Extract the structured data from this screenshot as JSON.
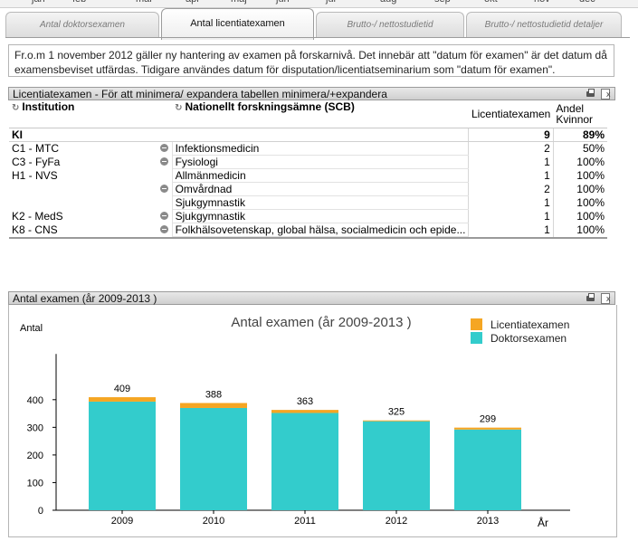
{
  "months": [
    "jan",
    "feb",
    "mar",
    "apr",
    "maj",
    "jun",
    "jul",
    "aug",
    "sep",
    "okt",
    "nov",
    "dec"
  ],
  "tabs": [
    {
      "label": "Antal doktorsexamen",
      "active": false
    },
    {
      "label": "Antal licentiatexamen",
      "active": true
    },
    {
      "label": "Brutto-/ nettostudietid",
      "active": false
    },
    {
      "label": "Brutto-/ nettostudietid detaljer",
      "active": false
    }
  ],
  "note": {
    "line1": "Fr.o.m 1 november 2012 gäller ny hantering av examen på forskarnivå. Det innebär att \"datum för examen\" är det datum då",
    "line2": "examensbeviset utfärdas. Tidigare användes datum för disputation/licentiatseminarium som \"datum för examen\"."
  },
  "table_panel": {
    "title": "Licentiatexamen - För att minimera/ expandera tabellen minimera/+expandera",
    "columns": {
      "institution": "Institution",
      "subject": "Nationellt forskningsämne (SCB)",
      "count": "Licentiatexamen",
      "women_l1": "Andel",
      "women_l2": "Kvinnor"
    },
    "total": {
      "label": "KI",
      "count": "9",
      "women": "89%"
    },
    "rows": [
      {
        "institution": "C1 - MTC",
        "collapse": true,
        "subject": "Infektionsmedicin",
        "count": "2",
        "women": "50%"
      },
      {
        "institution": "C3 - FyFa",
        "collapse": true,
        "subject": "Fysiologi",
        "count": "1",
        "women": "100%"
      },
      {
        "institution": "H1 - NVS",
        "collapse": false,
        "subject": "Allmänmedicin",
        "count": "1",
        "women": "100%"
      },
      {
        "institution": "",
        "collapse": true,
        "subject": "Omvårdnad",
        "count": "2",
        "women": "100%"
      },
      {
        "institution": "",
        "collapse": false,
        "subject": "Sjukgymnastik",
        "count": "1",
        "women": "100%"
      },
      {
        "institution": "K2 - MedS",
        "collapse": true,
        "subject": "Sjukgymnastik",
        "count": "1",
        "women": "100%"
      },
      {
        "institution": "K8 - CNS",
        "collapse": true,
        "subject": "Folkhälsovetenskap, global hälsa, socialmedicin och epide...",
        "count": "1",
        "women": "100%"
      }
    ]
  },
  "chart_panel": {
    "title": "Antal examen (år 2009-2013 )"
  },
  "colors": {
    "licentiat": "#f5a623",
    "doktors": "#33cccc"
  },
  "chart_data": {
    "type": "bar",
    "stacked": true,
    "title": "Antal examen (år 2009-2013 )",
    "ylabel": "Antal",
    "xlabel": "År",
    "categories": [
      "2009",
      "2010",
      "2011",
      "2012",
      "2013"
    ],
    "series": [
      {
        "name": "Doktorsexamen",
        "values": [
          393,
          370,
          352,
          322,
          292
        ]
      },
      {
        "name": "Licentiatexamen",
        "values": [
          16,
          18,
          11,
          3,
          7
        ]
      }
    ],
    "totals": [
      409,
      388,
      363,
      325,
      299
    ],
    "yticks": [
      0,
      100,
      200,
      300,
      400
    ],
    "ylim": [
      0,
      500
    ],
    "legend": "top-right",
    "grid": false
  }
}
